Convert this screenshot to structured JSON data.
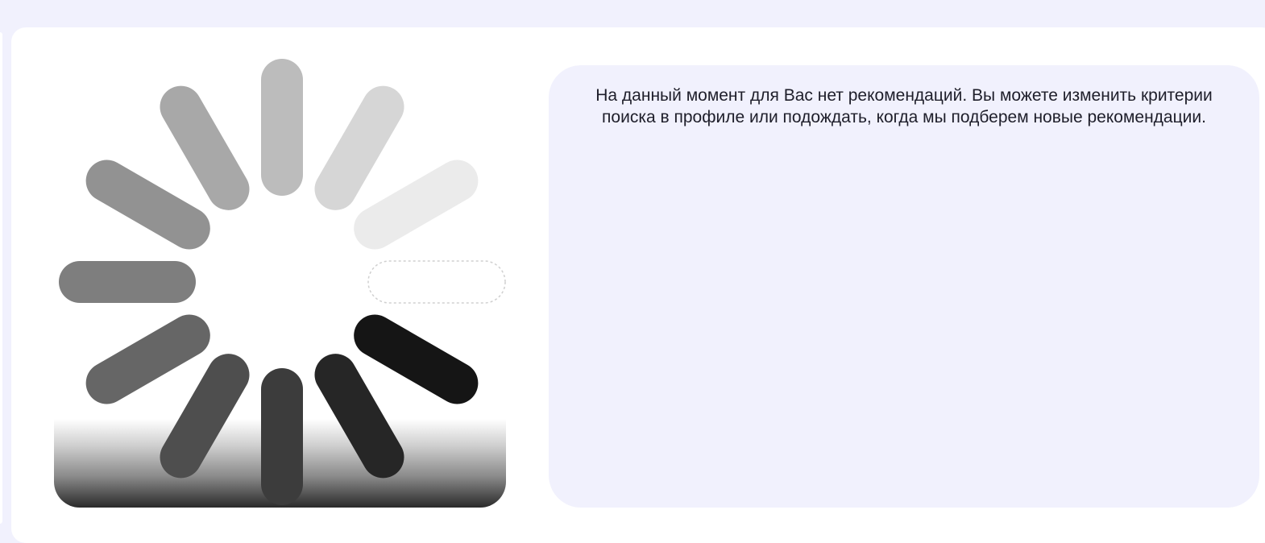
{
  "loader": {
    "icon": "spinner-icon",
    "spoke_colors": [
      "#bcbcbc",
      "#d6d6d6",
      "#ebebeb",
      "#ffffff",
      "#151515",
      "#262626",
      "#3c3c3c",
      "#4e4e4e",
      "#666666",
      "#7e7e7e",
      "#929292",
      "#a8a8a8"
    ]
  },
  "recommendations": {
    "empty_message": "На данный момент для Вас нет рекомендаций. Вы можете изменить критерии поиска в профиле или подождать, когда мы подберем новые рекомендации."
  }
}
